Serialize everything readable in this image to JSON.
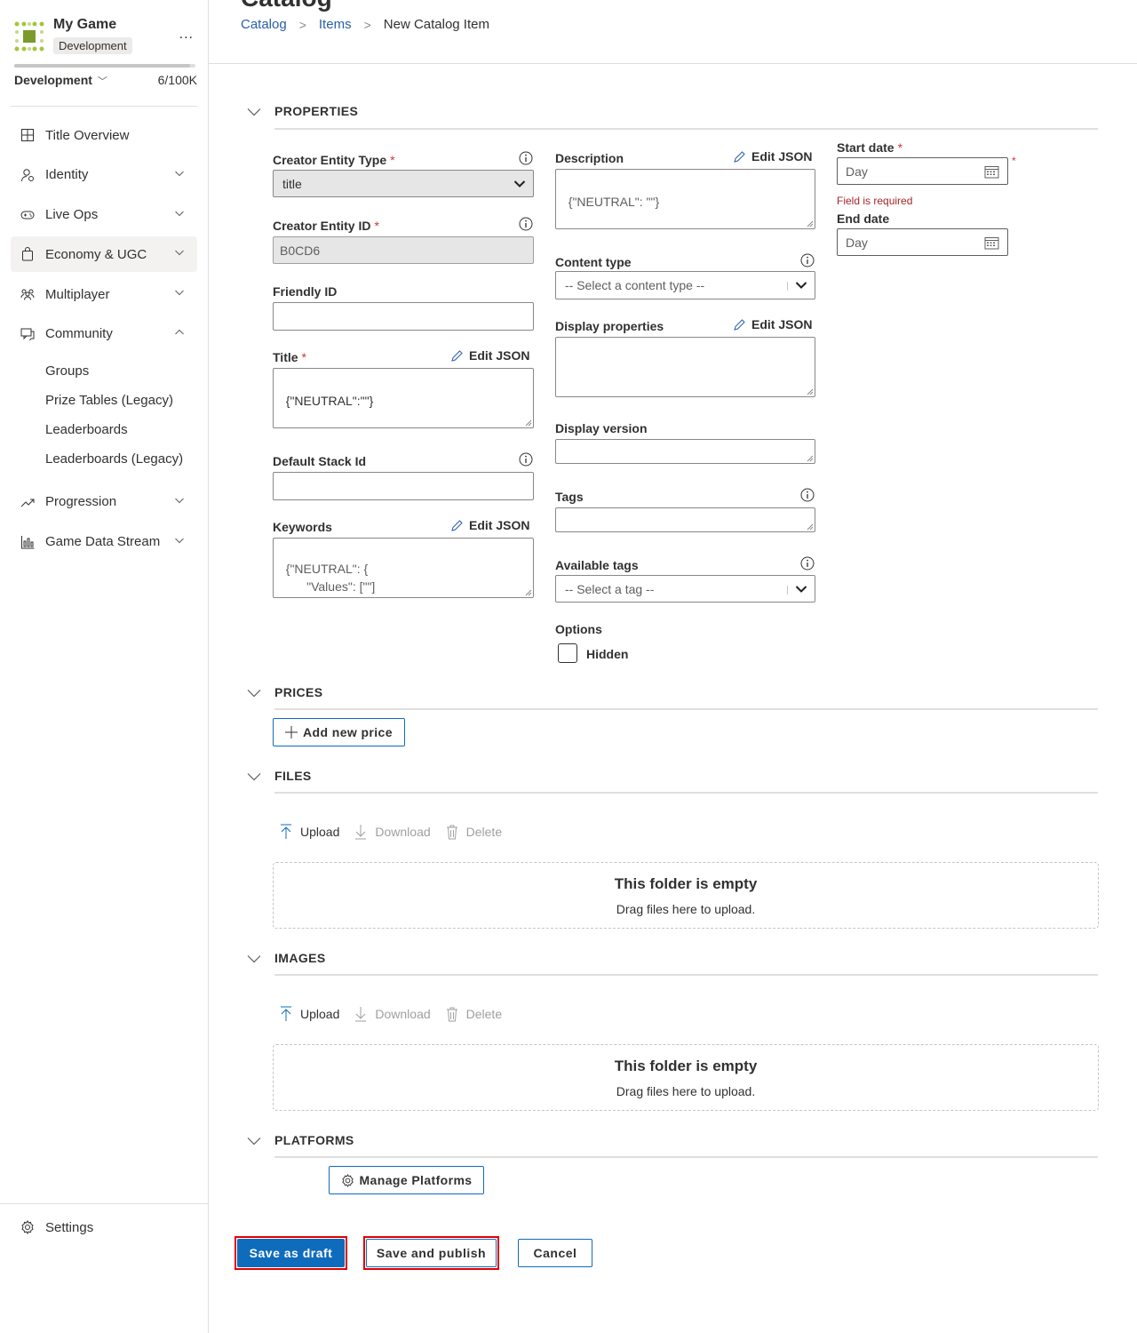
{
  "sidebar": {
    "game_name": "My Game",
    "env_badge": "Development",
    "more": "...",
    "environment": "Development",
    "usage": "6/100K",
    "usage_fraction": 0.97,
    "nav": [
      {
        "label": "Title Overview",
        "icon": "grid-icon"
      },
      {
        "label": "Identity",
        "icon": "identity-icon"
      },
      {
        "label": "Live Ops",
        "icon": "gamepad-icon"
      },
      {
        "label": "Economy & UGC",
        "icon": "shopping-bag-icon"
      },
      {
        "label": "Multiplayer",
        "icon": "people-icon"
      },
      {
        "label": "Community",
        "icon": "chat-icon"
      },
      {
        "label": "Progression",
        "icon": "trend-icon"
      },
      {
        "label": "Game Data Stream",
        "icon": "bar-chart-icon"
      }
    ],
    "community_sub": [
      "Groups",
      "Prize Tables (Legacy)",
      "Leaderboards",
      "Leaderboards (Legacy)"
    ],
    "settings": "Settings"
  },
  "header": {
    "title": "Catalog",
    "breadcrumb": [
      "Catalog",
      "Items",
      "New Catalog Item"
    ]
  },
  "sections": {
    "properties": "PROPERTIES",
    "prices": "PRICES",
    "files": "FILES",
    "images": "IMAGES",
    "platforms": "PLATFORMS"
  },
  "form": {
    "edit_json": "Edit JSON",
    "creator_entity_type": {
      "label": "Creator Entity Type",
      "value": "title"
    },
    "creator_entity_id": {
      "label": "Creator Entity ID",
      "value": "B0CD6"
    },
    "friendly_id": {
      "label": "Friendly ID",
      "value": ""
    },
    "title": {
      "label": "Title",
      "value": "{\"NEUTRAL\":\"\"}"
    },
    "default_stack_id": {
      "label": "Default Stack Id",
      "value": ""
    },
    "keywords": {
      "label": "Keywords",
      "value": "{\"NEUTRAL\": {\n        \"Values\": [\"\"]\n}}"
    },
    "description": {
      "label": "Description",
      "value": "{\"NEUTRAL\": \"\"}"
    },
    "content_type": {
      "label": "Content type",
      "placeholder": "-- Select a content type --"
    },
    "display_properties": {
      "label": "Display properties",
      "value": ""
    },
    "display_version": {
      "label": "Display version",
      "value": ""
    },
    "tags": {
      "label": "Tags",
      "value": ""
    },
    "available_tags": {
      "label": "Available tags",
      "placeholder": "-- Select a tag --"
    },
    "options": {
      "label": "Options",
      "hidden_label": "Hidden",
      "hidden_checked": false
    },
    "start_date": {
      "label": "Start date",
      "placeholder": "Day",
      "error": "Field is required"
    },
    "end_date": {
      "label": "End date",
      "placeholder": "Day"
    },
    "required_mark": "*"
  },
  "prices": {
    "add_button": "Add new price"
  },
  "files": {
    "upload": "Upload",
    "download": "Download",
    "delete": "Delete",
    "empty_title": "This folder is empty",
    "empty_sub": "Drag files here to upload."
  },
  "images": {
    "upload": "Upload",
    "download": "Download",
    "delete": "Delete",
    "empty_title": "This folder is empty",
    "empty_sub": "Drag files here to upload."
  },
  "platforms": {
    "manage_button": "Manage Platforms"
  },
  "footer": {
    "save_draft": "Save as draft",
    "save_publish": "Save and publish",
    "cancel": "Cancel"
  },
  "colors": {
    "accent": "#0f6cbd",
    "link": "#2b5ea8",
    "required": "#d13438",
    "error_text": "#a4262c",
    "highlight": "#e00000"
  }
}
